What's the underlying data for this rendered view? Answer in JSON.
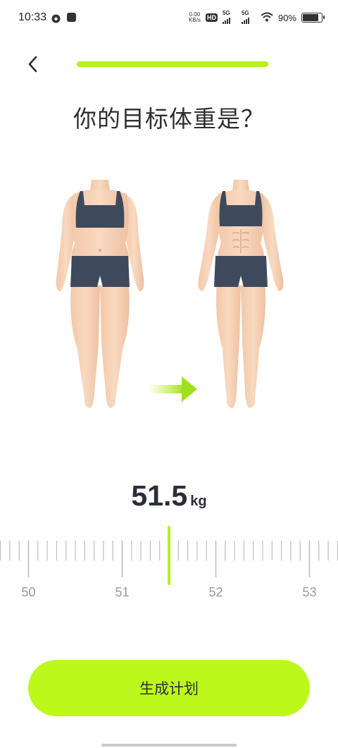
{
  "status_bar": {
    "time": "10:33",
    "net_speed_value": "0.00",
    "net_speed_unit": "KB/s",
    "hd_label": "HD",
    "sim1_label": "5G",
    "sim2_label": "5G",
    "battery_percent": "90%",
    "battery_level": 0.9
  },
  "header": {
    "progress": 1.0,
    "accent_color": "#b5f11b"
  },
  "title": "你的目标体重是？",
  "weight": {
    "value": "51.5",
    "unit": "kg"
  },
  "ruler": {
    "min": 49.7,
    "max": 53.3,
    "step": 0.1,
    "selected": 51.5,
    "labels": [
      "50",
      "51",
      "52",
      "53"
    ]
  },
  "cta_label": "生成计划"
}
